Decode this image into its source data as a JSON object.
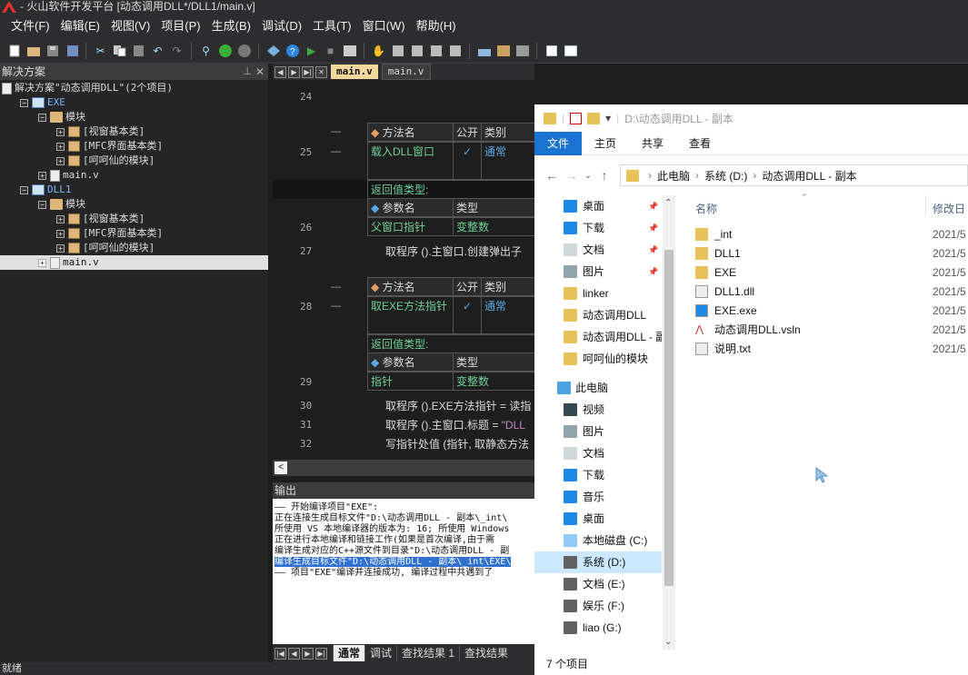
{
  "app": {
    "title": "- 火山软件开发平台 [动态调用DLL*/DLL1/main.v]"
  },
  "menu": [
    "文件(F)",
    "编辑(E)",
    "视图(V)",
    "项目(P)",
    "生成(B)",
    "调试(D)",
    "工具(T)",
    "窗口(W)",
    "帮助(H)"
  ],
  "solution": {
    "header": "解决方案",
    "rows": [
      {
        "label": "解决方案\"动态调用DLL\"(2个项目)",
        "indent": 0,
        "icon": "solution",
        "exp": ""
      },
      {
        "label": "EXE",
        "indent": 1,
        "icon": "project",
        "exp": "−"
      },
      {
        "label": "模块",
        "indent": 2,
        "icon": "folder",
        "exp": "−"
      },
      {
        "label": "[视窗基本类]",
        "indent": 3,
        "icon": "class",
        "exp": "+"
      },
      {
        "label": "[MFC界面基本类]",
        "indent": 3,
        "icon": "class",
        "exp": "+"
      },
      {
        "label": "[呵呵仙的模块]",
        "indent": 3,
        "icon": "class",
        "exp": "+"
      },
      {
        "label": "main.v",
        "indent": 2,
        "icon": "file",
        "exp": "+"
      },
      {
        "label": "DLL1",
        "indent": 1,
        "icon": "project",
        "exp": "−"
      },
      {
        "label": "模块",
        "indent": 2,
        "icon": "folder",
        "exp": "−"
      },
      {
        "label": "[视窗基本类]",
        "indent": 3,
        "icon": "class",
        "exp": "+"
      },
      {
        "label": "[MFC界面基本类]",
        "indent": 3,
        "icon": "class",
        "exp": "+"
      },
      {
        "label": "[呵呵仙的模块]",
        "indent": 3,
        "icon": "class",
        "exp": "+"
      },
      {
        "label": "main.v",
        "indent": 2,
        "icon": "file",
        "exp": "+",
        "selected": true
      }
    ]
  },
  "tabs": {
    "active": "main.v",
    "inactive": "main.v"
  },
  "editor": {
    "line_numbers": [
      "24",
      "25",
      "26",
      "27",
      "28",
      "29",
      "30",
      "31",
      "32"
    ],
    "method_name_hdr": "方法名",
    "public_hdr": "公开",
    "type_hdr": "类别",
    "return_label": "返回值类型:",
    "param_hdr": "参数名",
    "param_type_hdr": "类型",
    "m1": {
      "name": "载入DLL窗口",
      "check": "✓",
      "kind": "通常",
      "param": "父窗口指针",
      "ptype": "变整数"
    },
    "m2": {
      "name": "取EXE方法指针",
      "check": "✓",
      "kind": "通常",
      "param": "指针",
      "ptype": "变整数"
    },
    "code27": "取程序 ().主窗口.创建弹出子",
    "code30": "取程序 ().EXE方法指针 = 读指",
    "code31a": "取程序 ().主窗口.标题 = ",
    "code31b": "\"DLL",
    "code32": "写指针处值 (指针, 取静态方法"
  },
  "output": {
    "header": "输出",
    "lines": [
      "—— 开始编译项目\"EXE\":",
      "正在连接生成目标文件\"D:\\动态调用DLL - 副本\\_int\\",
      "所使用 VS 本地编译器的版本为: 16; 所使用 Windows",
      "正在进行本地编译和链接工作(如果是首次编译,由于需",
      "编译生成对应的C++源文件到目录\"D:\\动态调用DLL - 副",
      "编译生成目标文件\"D:\\动态调用DLL - 副本\\_int\\EXE\\",
      "—— 项目\"EXE\"编译并连接成功, 编译过程中共遇到了"
    ],
    "tabs": [
      "通常",
      "调试",
      "查找结果 1",
      "查找结果"
    ]
  },
  "status": "就绪",
  "explorer": {
    "title_path": "D:\\动态调用DLL - 副本",
    "ribbon": [
      "文件",
      "主页",
      "共享",
      "查看"
    ],
    "crumbs": [
      "此电脑",
      "系统 (D:)",
      "动态调用DLL - 副本"
    ],
    "nav": [
      {
        "label": "桌面",
        "icon": "desktop",
        "pin": true
      },
      {
        "label": "下载",
        "icon": "download",
        "pin": true
      },
      {
        "label": "文档",
        "icon": "docs",
        "pin": true
      },
      {
        "label": "图片",
        "icon": "pictures",
        "pin": true
      },
      {
        "label": "linker",
        "icon": "folder"
      },
      {
        "label": "动态调用DLL",
        "icon": "folder"
      },
      {
        "label": "动态调用DLL - 副",
        "icon": "folder"
      },
      {
        "label": "呵呵仙的模块",
        "icon": "folder"
      },
      {
        "label": "此电脑",
        "icon": "pc",
        "top": true
      },
      {
        "label": "视频",
        "icon": "video"
      },
      {
        "label": "图片",
        "icon": "pictures"
      },
      {
        "label": "文档",
        "icon": "docs"
      },
      {
        "label": "下载",
        "icon": "download"
      },
      {
        "label": "音乐",
        "icon": "music"
      },
      {
        "label": "桌面",
        "icon": "desktop"
      },
      {
        "label": "本地磁盘 (C:)",
        "icon": "drive-c"
      },
      {
        "label": "系统 (D:)",
        "icon": "drive",
        "selected": true
      },
      {
        "label": "文档 (E:)",
        "icon": "drive"
      },
      {
        "label": "娱乐 (F:)",
        "icon": "drive"
      },
      {
        "label": "liao (G:)",
        "icon": "drive"
      }
    ],
    "col_name": "名称",
    "col_date": "修改日",
    "files": [
      {
        "name": "_int",
        "type": "folder",
        "date": "2021/5"
      },
      {
        "name": "DLL1",
        "type": "folder",
        "date": "2021/5"
      },
      {
        "name": "EXE",
        "type": "folder",
        "date": "2021/5"
      },
      {
        "name": "DLL1.dll",
        "type": "dll",
        "date": "2021/5"
      },
      {
        "name": "EXE.exe",
        "type": "exe",
        "date": "2021/5"
      },
      {
        "name": "动态调用DLL.vsln",
        "type": "vsln",
        "date": "2021/5"
      },
      {
        "name": "说明.txt",
        "type": "txt",
        "date": "2021/5"
      }
    ],
    "status": "7 个项目"
  }
}
